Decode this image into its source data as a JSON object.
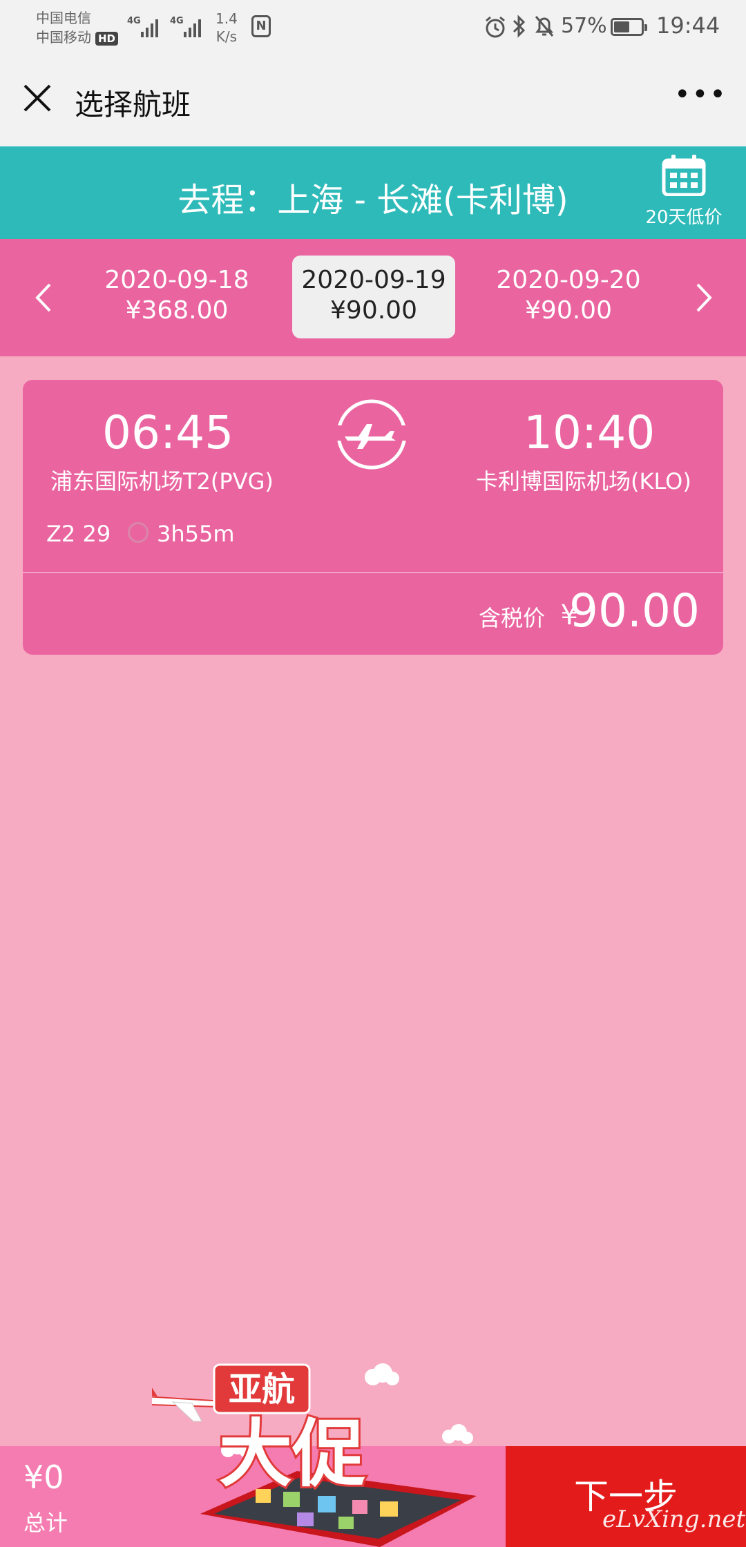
{
  "status_bar": {
    "carrier_1": "中国电信",
    "carrier_2": "中国移动",
    "hd_badge": "HD",
    "net_1": "4G",
    "net_2": "4G",
    "speed_value": "1.4",
    "speed_unit": "K/s",
    "nfc": "N",
    "battery_percent": "57%",
    "battery_level": 0.57,
    "time": "19:44"
  },
  "header": {
    "title": "选择航班",
    "more": "•••"
  },
  "route": {
    "title": "去程：上海 - 长滩(卡利博)",
    "calendar_label": "20天低价"
  },
  "dates": [
    {
      "date": "2020-09-18",
      "price": "¥368.00"
    },
    {
      "date": "2020-09-19",
      "price": "¥90.00"
    },
    {
      "date": "2020-09-20",
      "price": "¥90.00"
    }
  ],
  "flight": {
    "depart_time": "06:45",
    "depart_airport": "浦东国际机场T2(PVG)",
    "arrive_time": "10:40",
    "arrive_airport": "卡利博国际机场(KLO)",
    "flight_no": "Z2 29",
    "duration": "3h55m",
    "price_label": "含税价",
    "currency": "¥",
    "price": "90.00"
  },
  "promo": {
    "line1": "亚航",
    "line2": "大促"
  },
  "footer": {
    "total_value": "¥0",
    "total_label": "总计",
    "next_button": "下一步",
    "watermark": "eLvXing.net"
  },
  "colors": {
    "teal": "#2fbaba",
    "pink": "#ea65a0",
    "light_pink": "#f7abc2",
    "red": "#e41b1b"
  }
}
